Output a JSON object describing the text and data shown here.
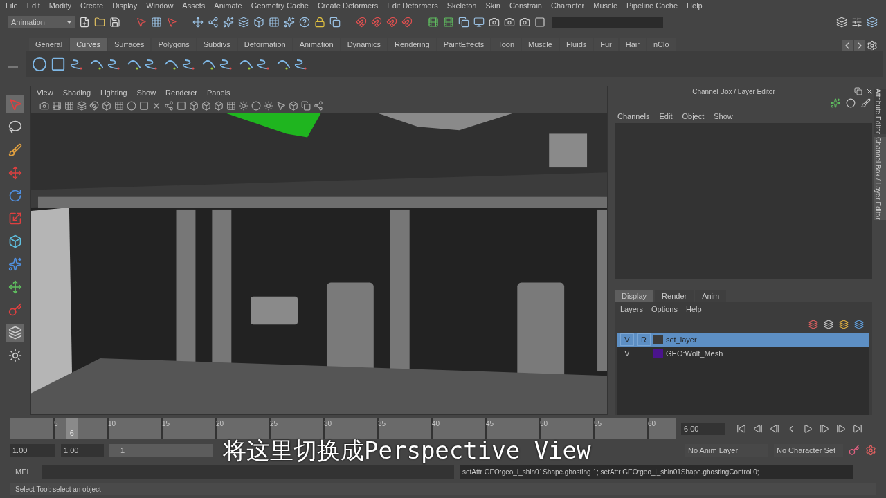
{
  "menu_bar": [
    "File",
    "Edit",
    "Modify",
    "Create",
    "Display",
    "Window",
    "Assets",
    "Animate",
    "Geometry Cache",
    "Create Deformers",
    "Edit Deformers",
    "Skeleton",
    "Skin",
    "Constrain",
    "Character",
    "Muscle",
    "Pipeline Cache",
    "Help"
  ],
  "status_line": {
    "mode": "Animation"
  },
  "shelf_tabs": [
    {
      "label": "General",
      "selected": false
    },
    {
      "label": "Curves",
      "selected": true
    },
    {
      "label": "Surfaces",
      "selected": false
    },
    {
      "label": "Polygons",
      "selected": false
    },
    {
      "label": "Subdivs",
      "selected": false
    },
    {
      "label": "Deformation",
      "selected": false
    },
    {
      "label": "Animation",
      "selected": false
    },
    {
      "label": "Dynamics",
      "selected": false
    },
    {
      "label": "Rendering",
      "selected": false
    },
    {
      "label": "PaintEffects",
      "selected": false
    },
    {
      "label": "Toon",
      "selected": false
    },
    {
      "label": "Muscle",
      "selected": false
    },
    {
      "label": "Fluids",
      "selected": false
    },
    {
      "label": "Fur",
      "selected": false
    },
    {
      "label": "Hair",
      "selected": false
    },
    {
      "label": "nClo",
      "selected": false
    }
  ],
  "viewport": {
    "menus": [
      "View",
      "Shading",
      "Lighting",
      "Show",
      "Renderer",
      "Panels"
    ]
  },
  "channel_box": {
    "title": "Channel Box / Layer Editor",
    "menus": [
      "Channels",
      "Edit",
      "Object",
      "Show"
    ]
  },
  "layer_editor": {
    "tabs": [
      {
        "label": "Display",
        "selected": true
      },
      {
        "label": "Render",
        "selected": false
      },
      {
        "label": "Anim",
        "selected": false
      }
    ],
    "menus": [
      "Layers",
      "Options",
      "Help"
    ],
    "layers": [
      {
        "visible": "V",
        "reference": "R",
        "name": "set_layer",
        "color": "#3c3c3c",
        "selected": true
      },
      {
        "visible": "V",
        "name": "GEO:Wolf_Mesh",
        "color": "#4a148c",
        "selected": false
      }
    ]
  },
  "side_tabs": [
    {
      "label": "Attribute Editor",
      "selected": false
    },
    {
      "label": "Channel Box / Layer Editor",
      "selected": true
    }
  ],
  "time_slider": {
    "ticks": [
      "5",
      "10",
      "15",
      "20",
      "25",
      "30",
      "35",
      "40",
      "45",
      "50",
      "55",
      "60"
    ],
    "current_frame": "6",
    "level": 0.085,
    "current_time": "6.00"
  },
  "range_slider": {
    "start_time": "1.00",
    "playback_start": "1.00",
    "slider_label": "1",
    "level": 1
  },
  "anim_layer": "No Anim Layer",
  "character_set": "No Character Set",
  "subtitle": "将这里切换成Perspective View",
  "command_line": {
    "language": "MEL",
    "result": "setAttr GEO:geo_l_shin01Shape.ghosting 1; setAttr GEO:geo_l_shin01Shape.ghostingControl 0;"
  },
  "help_line": "Select Tool: select an object"
}
